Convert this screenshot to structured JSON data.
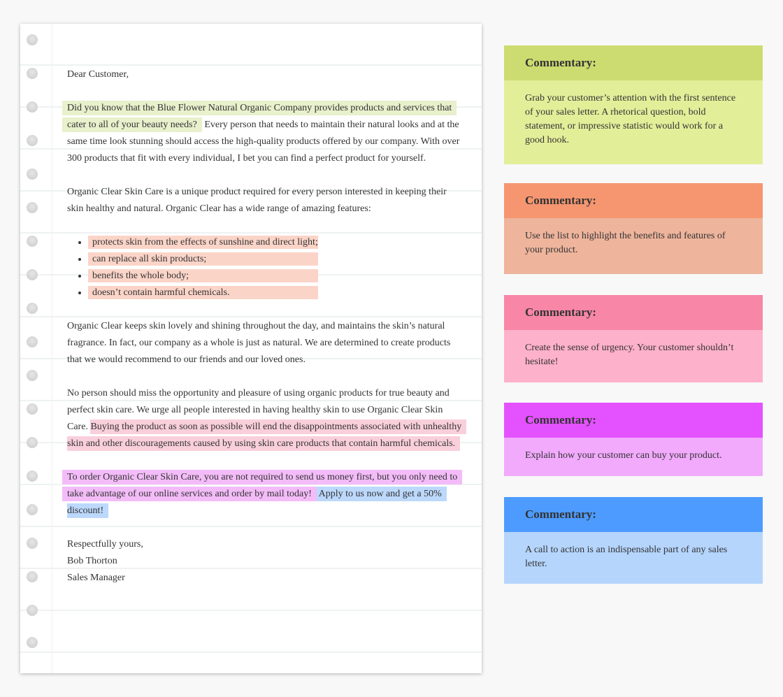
{
  "letter": {
    "greeting": "Dear Customer,",
    "para1": {
      "highlight": "Did you know that the Blue Flower Natural Organic Company provides products and services that cater to all of your beauty needs?",
      "rest": " Every person that needs to maintain their natural looks and at the same time look stunning should access the high-quality products offered by our company. With over 300 products that fit with every individual, I bet you can find a perfect product for yourself."
    },
    "para2": "Organic Clear Skin Care is a unique product required for every person interested in keeping their skin healthy and natural. Organic Clear has a wide range of amazing features:",
    "features": [
      "protects skin from the effects of sunshine and direct light;",
      "can replace all skin products;",
      "benefits the whole body;",
      "doesn’t contain harmful chemicals."
    ],
    "para3": "Organic Clear keeps skin lovely and shining throughout the day, and maintains the skin’s natural fragrance. In fact, our company as a whole is just as natural. We are determined to create products that we would recommend to our friends and our loved ones.",
    "para4": {
      "plain": "No person should miss the opportunity and pleasure of using organic products for true beauty and perfect skin care. We urge all people interested in having healthy skin to use Organic Clear Skin Care. ",
      "highlight": "Buying the product as soon as possible will end the disappointments associated with unhealthy skin and other discouragements caused by using skin care products that contain harmful chemicals."
    },
    "para5": {
      "order": "To order Organic Clear Skin Care, you are not required to send us money first, but you only need to take advantage of our online services and order by mail today!",
      "cta": " Apply to us now and get a 50% discount!"
    },
    "closing": "Respectfully yours,",
    "name": "Bob Thorton",
    "title": "Sales Manager"
  },
  "commentaries": [
    {
      "heading": "Commentary:",
      "text": "Grab your customer’s attention with the first sentence of your sales letter. A rhetorical question, bold statement, or impressive statistic would work for a good hook.",
      "head_color": "#cddc70",
      "body_color": "#e3ee99"
    },
    {
      "heading": "Commentary:",
      "text": "Use the list to highlight the benefits and features of your product.",
      "head_color": "#f59670",
      "body_color": "#eeb49c"
    },
    {
      "heading": "Commentary:",
      "text": "Create the sense of urgency. Your customer shouldn’t hesitate!",
      "head_color": "#f886a7",
      "body_color": "#feb1ca"
    },
    {
      "heading": "Commentary:",
      "text": "Explain how your customer can buy your product.",
      "head_color": "#e451fe",
      "body_color": "#f1aafc"
    },
    {
      "heading": "Commentary:",
      "text": "A call to action is an indispensable part of any sales letter.",
      "head_color": "#4d9bfe",
      "body_color": "#b5d5fd"
    }
  ]
}
